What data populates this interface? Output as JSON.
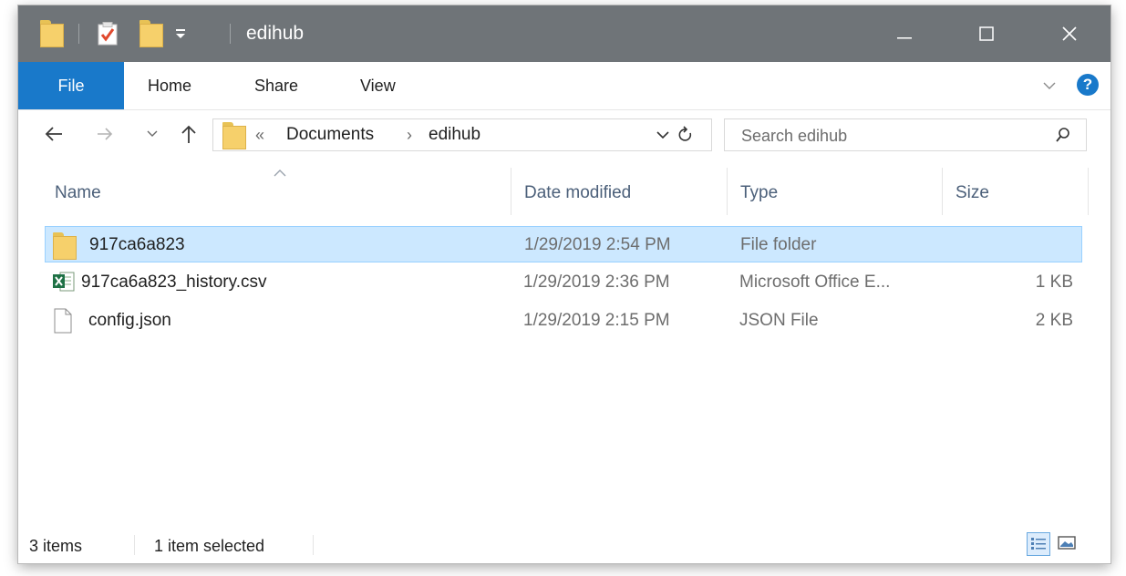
{
  "window": {
    "title": "edihub"
  },
  "ribbon": {
    "tabs": [
      {
        "label": "File"
      },
      {
        "label": "Home"
      },
      {
        "label": "Share"
      },
      {
        "label": "View"
      }
    ],
    "help_label": "?"
  },
  "nav": {
    "breadcrumb_overflow": "«",
    "breadcrumb": [
      {
        "label": "Documents"
      },
      {
        "label": "edihub"
      }
    ],
    "crumb_separator": "›",
    "search_placeholder": "Search edihub"
  },
  "columns": [
    {
      "label": "Name"
    },
    {
      "label": "Date modified"
    },
    {
      "label": "Type"
    },
    {
      "label": "Size"
    }
  ],
  "files": [
    {
      "name": "917ca6a823",
      "date": "1/29/2019 2:54 PM",
      "type": "File folder",
      "size": "",
      "icon": "folder-icon",
      "selected": true
    },
    {
      "name": "917ca6a823_history.csv",
      "date": "1/29/2019 2:36 PM",
      "type": "Microsoft Office E...",
      "size": "1 KB",
      "icon": "excel-csv-icon",
      "selected": false
    },
    {
      "name": "config.json",
      "date": "1/29/2019 2:15 PM",
      "type": "JSON File",
      "size": "2 KB",
      "icon": "blank-file-icon",
      "selected": false
    }
  ],
  "status": {
    "item_count": "3 items",
    "selection": "1 item selected"
  },
  "colors": {
    "titlebar": "#6f7478",
    "file_tab": "#1979ca",
    "selected_row": "#cce8ff",
    "selected_border": "#99d1ff",
    "folder": "#f6d06b"
  }
}
